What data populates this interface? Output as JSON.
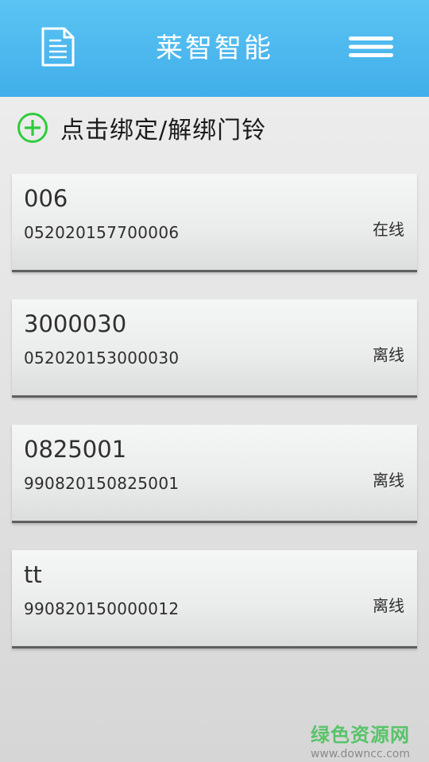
{
  "header": {
    "title": "莱智智能",
    "left_icon": "document-icon",
    "right_icon": "menu-icon",
    "bg_color": "#4ab8ee"
  },
  "bind_action": {
    "icon": "plus-circle-icon",
    "label": "点击绑定/解绑门铃",
    "icon_color": "#2ecc3a"
  },
  "devices": [
    {
      "name": "006",
      "id": "052020157700006",
      "status": "在线"
    },
    {
      "name": "3000030",
      "id": "052020153000030",
      "status": "离线"
    },
    {
      "name": "0825001",
      "id": "990820150825001",
      "status": "离线"
    },
    {
      "name": "tt",
      "id": "990820150000012",
      "status": "离线"
    }
  ],
  "watermark": {
    "main": "绿色资源网",
    "sub": "www.downcc.com"
  }
}
